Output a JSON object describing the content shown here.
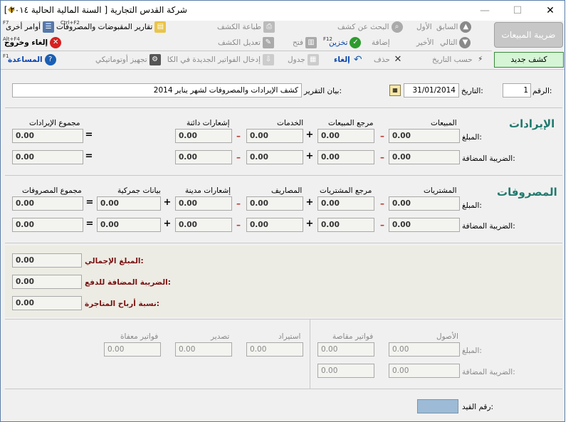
{
  "window": {
    "title": "شركة القدس التجارية  [ السنة المالية الحالية ٢٠١٤ ]",
    "minimize": "—",
    "maximize": "☐",
    "close": "✕"
  },
  "toolbar": {
    "row1": {
      "previous": "السابق",
      "first": "الأول",
      "search": "البحث عن كشف",
      "print": "طباعة الكشف",
      "reports": "تقارير المقبوضات والمصروفات",
      "reports_key": "Ctrl+F2",
      "more": "أوامر أخرى",
      "more_key": "F7"
    },
    "row2": {
      "next": "التالي",
      "last": "الأخير",
      "add": "إضافة",
      "save": "تخزين",
      "save_key": "F12",
      "open": "فتح",
      "edit": "تعديل الكشف",
      "cancel_exit": "إلغاء وخروج",
      "cancel_exit_key": "Alt+F4"
    },
    "row3": {
      "by_date": "حسب التاريخ",
      "delete": "حذف",
      "undo": "إلغاء",
      "table": "جدول",
      "import_invoices": "إدخال الفواتير الجديدة في الكا",
      "auto_prep": "تجهيز أوتوماتيكي",
      "help": "المساعدة",
      "help_key": "F1"
    }
  },
  "sales_tax_button": "ضريبة المبيعات",
  "new_statement_button": "كشف جديد",
  "header": {
    "number_label": "الرقم:",
    "number": "1",
    "date_label": "التاريخ:",
    "date": "31/01/2014",
    "report_label": "بيان التقرير:",
    "report_text": "كشف الإيرادات والمصروفات لشهر يناير 2014"
  },
  "revenue": {
    "title": "الإيرادات",
    "headers": {
      "sales": "المبيعات",
      "sales_returns": "مرجع المبيعات",
      "services": "الخدمات",
      "credit_notes": "إشعارات دائنة",
      "total": "مجموع الإيرادات"
    },
    "amount_label": "المبلغ:",
    "vat_label": "الضريبة المضافة:",
    "amount": {
      "sales": "0.00",
      "sales_returns": "0.00",
      "services": "0.00",
      "credit_notes": "0.00",
      "total": "0.00"
    },
    "vat": {
      "sales": "0.00",
      "sales_returns": "0.00",
      "services": "0.00",
      "credit_notes": "0.00",
      "total": "0.00"
    }
  },
  "expenses": {
    "title": "المصروفات",
    "headers": {
      "purchases": "المشتريات",
      "purchase_returns": "مرجع المشتريات",
      "expenses": "المصاريف",
      "debit_notes": "إشعارات مدينة",
      "customs": "بيانات جمركية",
      "total": "مجموع المصروفات"
    },
    "amount_label": "المبلغ:",
    "vat_label": "الضريبة المضافة:",
    "amount": {
      "purchases": "0.00",
      "purchase_returns": "0.00",
      "expenses": "0.00",
      "debit_notes": "0.00",
      "customs": "0.00",
      "total": "0.00"
    },
    "vat": {
      "purchases": "0.00",
      "purchase_returns": "0.00",
      "expenses": "0.00",
      "debit_notes": "0.00",
      "customs": "0.00",
      "total": "0.00"
    }
  },
  "totals": {
    "gross_label": "المبلغ الإجمالي:",
    "gross": "0.00",
    "vat_due_label": "الضريبة المضافة للدفع:",
    "vat_due": "0.00",
    "margin_label": "نسبة أرباح المتاجرة:",
    "margin": "0.00"
  },
  "other": {
    "headers": {
      "assets": "الأصول",
      "offset_invoices": "فواتير مقاصة",
      "import": "استيراد",
      "export": "تصدير",
      "exempt_invoices": "فواتير معفاة"
    },
    "amount_label": "المبلغ:",
    "vat_label": "الضريبة المضافة:",
    "amount": {
      "assets": "0.00",
      "offset_invoices": "0.00",
      "import": "0.00",
      "export": "0.00",
      "exempt_invoices": "0.00"
    },
    "vat": {
      "assets": "0.00",
      "offset_invoices": "0.00"
    }
  },
  "entry": {
    "label": "رقم القيد:",
    "value": ""
  }
}
